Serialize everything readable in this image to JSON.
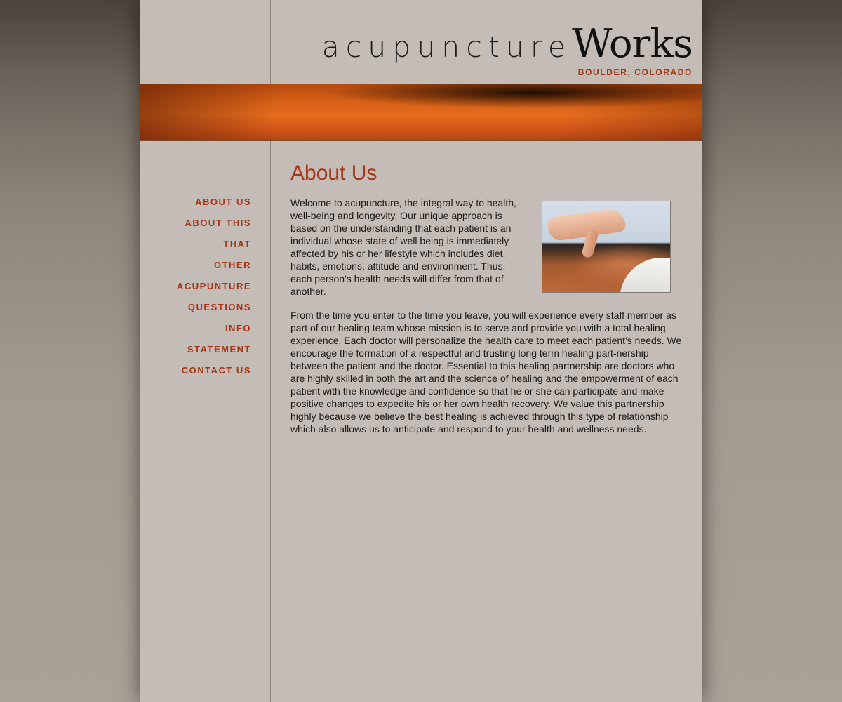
{
  "header": {
    "logo_light": "acupuncture",
    "logo_bold": "Works",
    "tagline": "BOULDER, COLORADO"
  },
  "nav": {
    "items": [
      {
        "label": "ABOUT US"
      },
      {
        "label": "ABOUT THIS"
      },
      {
        "label": "THAT"
      },
      {
        "label": "OTHER"
      },
      {
        "label": "ACUPUNTURE"
      },
      {
        "label": "QUESTIONS"
      },
      {
        "label": "INFO"
      },
      {
        "label": "STATEMENT"
      },
      {
        "label": "CONTACT US"
      }
    ]
  },
  "main": {
    "title": "About Us",
    "paragraph1": "Welcome to acupuncture, the integral way to health, well-being and longevity. Our unique approach is based on the understanding that each patient is an individual whose state of well being is immediately affected by his or her lifestyle which includes diet, habits, emotions, attitude and environment. Thus, each person's health needs will differ from that of another.",
    "paragraph2": "From the time you enter to the time you leave, you will experience every staff member as part of our healing team whose mission is to serve and provide you with a total healing experience. Each doctor will personalize the health care to meet each patient's needs. We encourage the formation of a respectful and trusting long term healing part-nership between the patient and the doctor. Essential to this healing partnership are doctors who are highly skilled in both the art and the science of healing and the empowerment of each patient with the knowledge and confidence so that he or she can participate and make positive changes to expedite his or her own health recovery. We value this partnership highly because we believe the best healing is achieved through this type of relationship which also allows us to anticipate and respond to your health and wellness needs."
  },
  "colors": {
    "accent": "#a83413",
    "panel": "#c4bcb6",
    "banner": "#e06a1c"
  }
}
